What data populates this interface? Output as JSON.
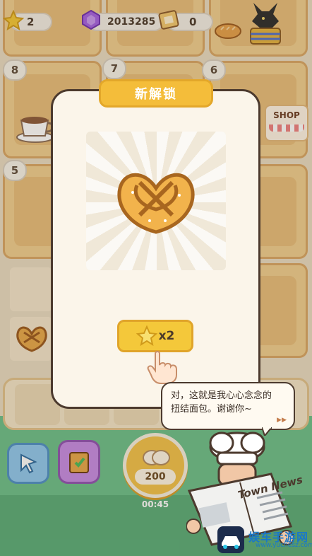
{
  "hud": {
    "stars": "2",
    "gems": "2013285",
    "tickets": "0"
  },
  "board": {
    "tags": [
      "8",
      "7",
      "6",
      "5"
    ],
    "shop_label": "SHOP"
  },
  "popup": {
    "title": "新解锁",
    "item_icon": "pretzel",
    "reward_icon": "star-icon",
    "reward_text": "x2"
  },
  "dialog": {
    "line1": "对，这就是我心心念念的",
    "line2": "扭结面包。谢谢你~",
    "next_indicator": "▶▶"
  },
  "bottom": {
    "produce_cost": "200",
    "timer": "00:45"
  },
  "newspaper_title": "Town News",
  "watermark": {
    "name": "娱车手游网",
    "url": "www.yuchesz.com"
  },
  "colors": {
    "accent_yellow": "#f4bd3a",
    "panel_bg": "#fbf5ea",
    "outline": "#4c3a2e",
    "ground_green": "#6cc08a"
  }
}
